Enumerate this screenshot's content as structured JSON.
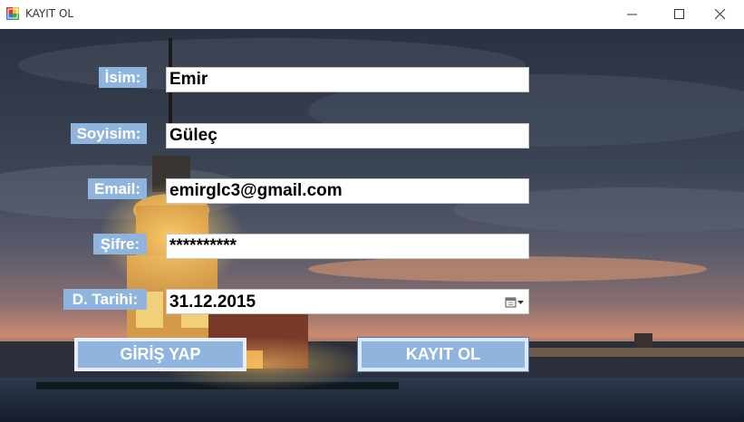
{
  "window": {
    "title": "KAYIT OL"
  },
  "form": {
    "isim_label": "İsim:",
    "isim_value": "Emir",
    "soyisim_label": "Soyisim:",
    "soyisim_value": "Güleç",
    "email_label": "Email:",
    "email_value": "emirglc3@gmail.com",
    "sifre_label": "Şifre:",
    "sifre_value": "**********",
    "tarih_label": "D. Tarihi:",
    "tarih_value": "31.12.2015"
  },
  "buttons": {
    "giris_label": "GİRİŞ YAP",
    "kayit_label": "KAYIT OL"
  },
  "colors": {
    "label_bg": "#8fb4dd",
    "button_bg": "#8fb4dd",
    "focus_border": "#4a78c0"
  },
  "icons": [
    "app-icon",
    "minimize-icon",
    "maximize-icon",
    "close-icon",
    "calendar-dropdown-icon"
  ]
}
